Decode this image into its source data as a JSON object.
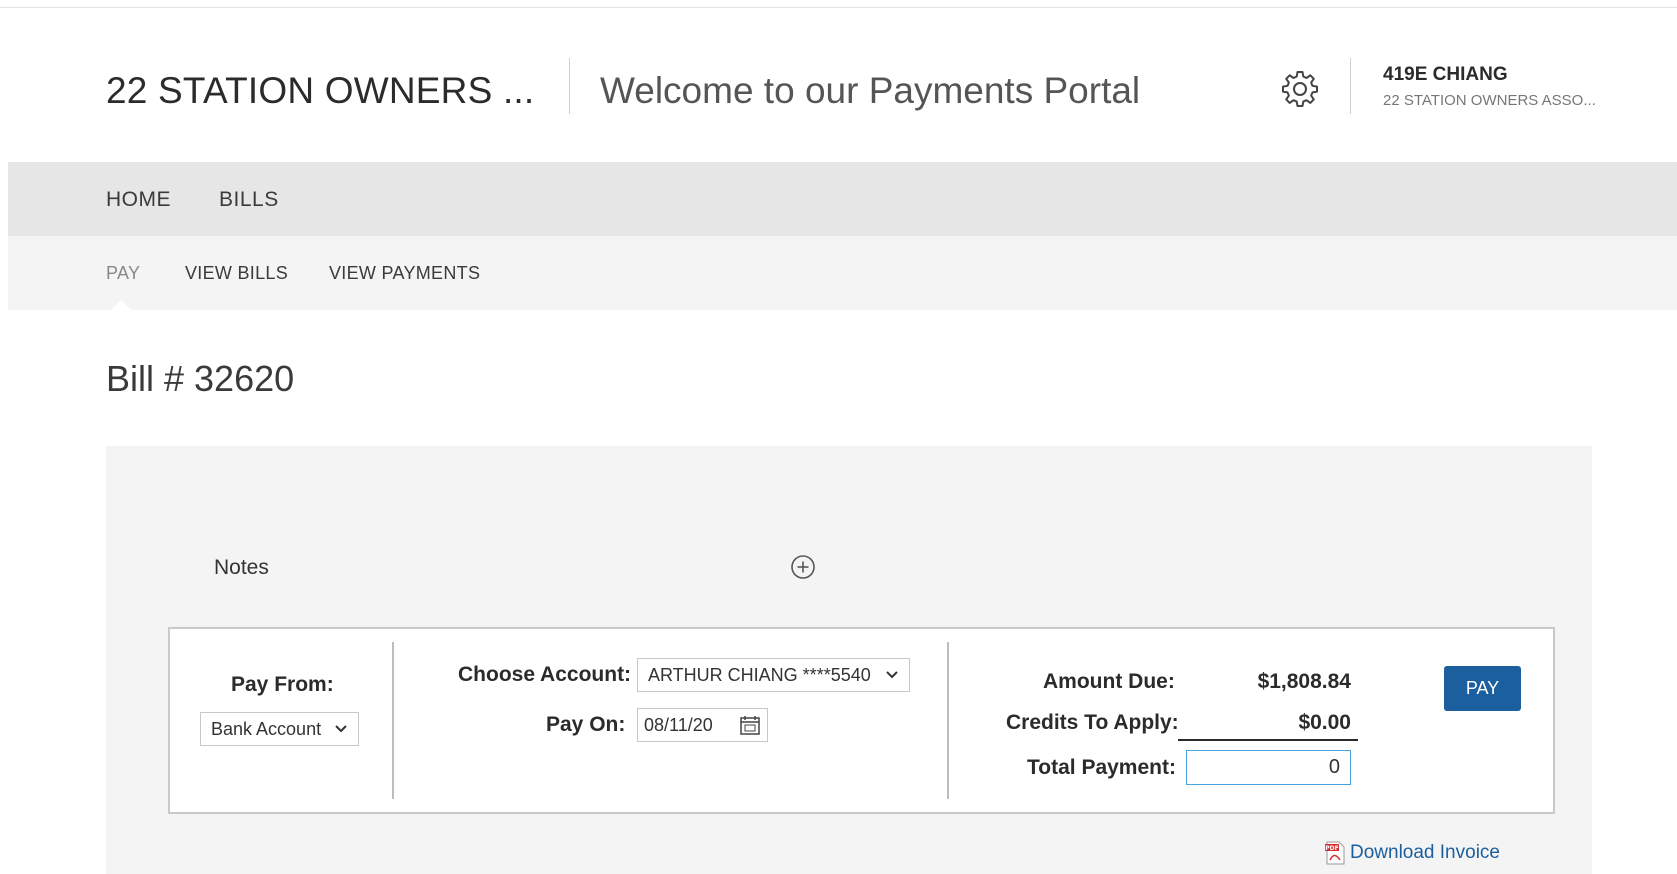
{
  "header": {
    "org_title": "22 STATION OWNERS ...",
    "welcome": "Welcome to our Payments Portal",
    "user_name": "419E CHIANG",
    "user_org": "22 STATION OWNERS ASSO..."
  },
  "nav_primary": [
    "HOME",
    "BILLS"
  ],
  "nav_secondary": [
    {
      "label": "PAY",
      "active": true
    },
    {
      "label": "VIEW BILLS",
      "active": false
    },
    {
      "label": "VIEW PAYMENTS",
      "active": false
    }
  ],
  "bill": {
    "title": "Bill # 32620"
  },
  "notes": {
    "label": "Notes"
  },
  "payment": {
    "pay_from_label": "Pay From:",
    "pay_from_value": "Bank Account",
    "choose_account_label": "Choose Account:",
    "choose_account_value": "ARTHUR CHIANG ****5540",
    "pay_on_label": "Pay On:",
    "pay_on_value": "08/11/20",
    "amount_due_label": "Amount Due:",
    "amount_due_value": "$1,808.84",
    "credits_label": "Credits To Apply:",
    "credits_value": "$0.00",
    "total_label": "Total Payment:",
    "total_value": "0",
    "pay_button": "PAY"
  },
  "download": {
    "label": "Download Invoice"
  },
  "colors": {
    "accent": "#1b5f9e",
    "input_focus": "#4aa3df",
    "nav_primary_bg": "#e6e6e6",
    "nav_secondary_bg": "#f4f4f4",
    "pdf_red": "#d32f2f"
  },
  "icons": {
    "settings": "gear-icon",
    "add_notes": "plus-circle-icon",
    "date_picker": "calendar-icon",
    "dropdown": "chevron-down-icon",
    "download": "pdf-icon"
  }
}
